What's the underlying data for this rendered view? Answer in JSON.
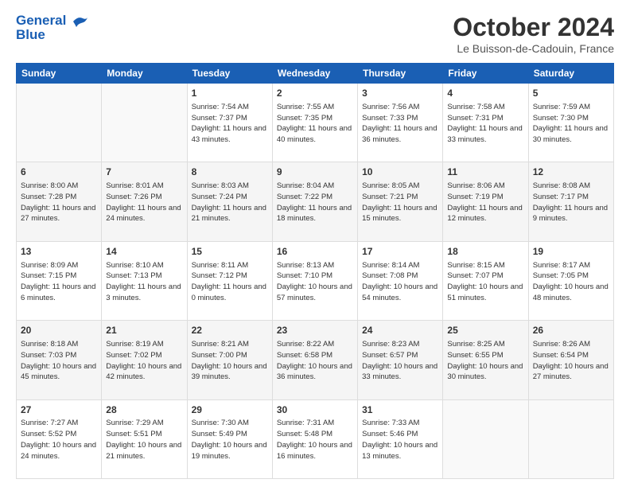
{
  "header": {
    "logo_line1": "General",
    "logo_line2": "Blue",
    "month_title": "October 2024",
    "location": "Le Buisson-de-Cadouin, France"
  },
  "weekdays": [
    "Sunday",
    "Monday",
    "Tuesday",
    "Wednesday",
    "Thursday",
    "Friday",
    "Saturday"
  ],
  "weeks": [
    [
      {
        "day": "",
        "sunrise": "",
        "sunset": "",
        "daylight": ""
      },
      {
        "day": "",
        "sunrise": "",
        "sunset": "",
        "daylight": ""
      },
      {
        "day": "1",
        "sunrise": "Sunrise: 7:54 AM",
        "sunset": "Sunset: 7:37 PM",
        "daylight": "Daylight: 11 hours and 43 minutes."
      },
      {
        "day": "2",
        "sunrise": "Sunrise: 7:55 AM",
        "sunset": "Sunset: 7:35 PM",
        "daylight": "Daylight: 11 hours and 40 minutes."
      },
      {
        "day": "3",
        "sunrise": "Sunrise: 7:56 AM",
        "sunset": "Sunset: 7:33 PM",
        "daylight": "Daylight: 11 hours and 36 minutes."
      },
      {
        "day": "4",
        "sunrise": "Sunrise: 7:58 AM",
        "sunset": "Sunset: 7:31 PM",
        "daylight": "Daylight: 11 hours and 33 minutes."
      },
      {
        "day": "5",
        "sunrise": "Sunrise: 7:59 AM",
        "sunset": "Sunset: 7:30 PM",
        "daylight": "Daylight: 11 hours and 30 minutes."
      }
    ],
    [
      {
        "day": "6",
        "sunrise": "Sunrise: 8:00 AM",
        "sunset": "Sunset: 7:28 PM",
        "daylight": "Daylight: 11 hours and 27 minutes."
      },
      {
        "day": "7",
        "sunrise": "Sunrise: 8:01 AM",
        "sunset": "Sunset: 7:26 PM",
        "daylight": "Daylight: 11 hours and 24 minutes."
      },
      {
        "day": "8",
        "sunrise": "Sunrise: 8:03 AM",
        "sunset": "Sunset: 7:24 PM",
        "daylight": "Daylight: 11 hours and 21 minutes."
      },
      {
        "day": "9",
        "sunrise": "Sunrise: 8:04 AM",
        "sunset": "Sunset: 7:22 PM",
        "daylight": "Daylight: 11 hours and 18 minutes."
      },
      {
        "day": "10",
        "sunrise": "Sunrise: 8:05 AM",
        "sunset": "Sunset: 7:21 PM",
        "daylight": "Daylight: 11 hours and 15 minutes."
      },
      {
        "day": "11",
        "sunrise": "Sunrise: 8:06 AM",
        "sunset": "Sunset: 7:19 PM",
        "daylight": "Daylight: 11 hours and 12 minutes."
      },
      {
        "day": "12",
        "sunrise": "Sunrise: 8:08 AM",
        "sunset": "Sunset: 7:17 PM",
        "daylight": "Daylight: 11 hours and 9 minutes."
      }
    ],
    [
      {
        "day": "13",
        "sunrise": "Sunrise: 8:09 AM",
        "sunset": "Sunset: 7:15 PM",
        "daylight": "Daylight: 11 hours and 6 minutes."
      },
      {
        "day": "14",
        "sunrise": "Sunrise: 8:10 AM",
        "sunset": "Sunset: 7:13 PM",
        "daylight": "Daylight: 11 hours and 3 minutes."
      },
      {
        "day": "15",
        "sunrise": "Sunrise: 8:11 AM",
        "sunset": "Sunset: 7:12 PM",
        "daylight": "Daylight: 11 hours and 0 minutes."
      },
      {
        "day": "16",
        "sunrise": "Sunrise: 8:13 AM",
        "sunset": "Sunset: 7:10 PM",
        "daylight": "Daylight: 10 hours and 57 minutes."
      },
      {
        "day": "17",
        "sunrise": "Sunrise: 8:14 AM",
        "sunset": "Sunset: 7:08 PM",
        "daylight": "Daylight: 10 hours and 54 minutes."
      },
      {
        "day": "18",
        "sunrise": "Sunrise: 8:15 AM",
        "sunset": "Sunset: 7:07 PM",
        "daylight": "Daylight: 10 hours and 51 minutes."
      },
      {
        "day": "19",
        "sunrise": "Sunrise: 8:17 AM",
        "sunset": "Sunset: 7:05 PM",
        "daylight": "Daylight: 10 hours and 48 minutes."
      }
    ],
    [
      {
        "day": "20",
        "sunrise": "Sunrise: 8:18 AM",
        "sunset": "Sunset: 7:03 PM",
        "daylight": "Daylight: 10 hours and 45 minutes."
      },
      {
        "day": "21",
        "sunrise": "Sunrise: 8:19 AM",
        "sunset": "Sunset: 7:02 PM",
        "daylight": "Daylight: 10 hours and 42 minutes."
      },
      {
        "day": "22",
        "sunrise": "Sunrise: 8:21 AM",
        "sunset": "Sunset: 7:00 PM",
        "daylight": "Daylight: 10 hours and 39 minutes."
      },
      {
        "day": "23",
        "sunrise": "Sunrise: 8:22 AM",
        "sunset": "Sunset: 6:58 PM",
        "daylight": "Daylight: 10 hours and 36 minutes."
      },
      {
        "day": "24",
        "sunrise": "Sunrise: 8:23 AM",
        "sunset": "Sunset: 6:57 PM",
        "daylight": "Daylight: 10 hours and 33 minutes."
      },
      {
        "day": "25",
        "sunrise": "Sunrise: 8:25 AM",
        "sunset": "Sunset: 6:55 PM",
        "daylight": "Daylight: 10 hours and 30 minutes."
      },
      {
        "day": "26",
        "sunrise": "Sunrise: 8:26 AM",
        "sunset": "Sunset: 6:54 PM",
        "daylight": "Daylight: 10 hours and 27 minutes."
      }
    ],
    [
      {
        "day": "27",
        "sunrise": "Sunrise: 7:27 AM",
        "sunset": "Sunset: 5:52 PM",
        "daylight": "Daylight: 10 hours and 24 minutes."
      },
      {
        "day": "28",
        "sunrise": "Sunrise: 7:29 AM",
        "sunset": "Sunset: 5:51 PM",
        "daylight": "Daylight: 10 hours and 21 minutes."
      },
      {
        "day": "29",
        "sunrise": "Sunrise: 7:30 AM",
        "sunset": "Sunset: 5:49 PM",
        "daylight": "Daylight: 10 hours and 19 minutes."
      },
      {
        "day": "30",
        "sunrise": "Sunrise: 7:31 AM",
        "sunset": "Sunset: 5:48 PM",
        "daylight": "Daylight: 10 hours and 16 minutes."
      },
      {
        "day": "31",
        "sunrise": "Sunrise: 7:33 AM",
        "sunset": "Sunset: 5:46 PM",
        "daylight": "Daylight: 10 hours and 13 minutes."
      },
      {
        "day": "",
        "sunrise": "",
        "sunset": "",
        "daylight": ""
      },
      {
        "day": "",
        "sunrise": "",
        "sunset": "",
        "daylight": ""
      }
    ]
  ]
}
